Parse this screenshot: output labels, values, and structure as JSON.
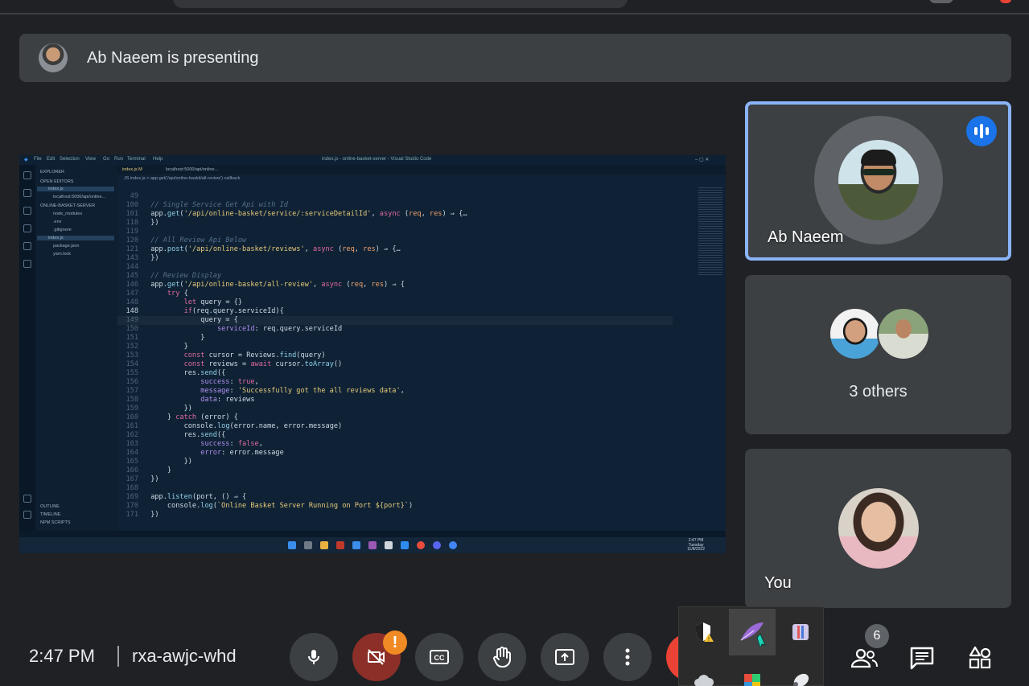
{
  "presenting": {
    "text": "Ab Naeem is presenting"
  },
  "shared_screen": {
    "window_title": "index.js - online-basket-server - Visual Studio Code",
    "menu": [
      "File",
      "Edit",
      "Selection",
      "View",
      "Go",
      "Run",
      "Terminal",
      "Help"
    ],
    "tabs": [
      "index.js M",
      "localhost:5000/api/online..."
    ],
    "breadcrumb": "JS index.js > app.get('/api/online-baskit/all-review') callback",
    "explorer": {
      "title": "EXPLORER",
      "open_editors": "OPEN EDITORS",
      "open_items": [
        "index.js",
        "localhost:5000/api/online..."
      ],
      "project": "ONLINE-BASKET-SERVER",
      "files": [
        "node_modules",
        ".env",
        ".gitignore",
        "index.js",
        "package.json",
        "yarn.lock"
      ],
      "footer": [
        "OUTLINE",
        "TIMELINE",
        "NPM SCRIPTS"
      ]
    },
    "taskbar_clock": {
      "time": "2:47 PM",
      "day": "Tuesday",
      "date": "11/8/2022"
    }
  },
  "tiles": {
    "presenter": {
      "name": "Ab Naeem"
    },
    "others": {
      "label": "3 others"
    },
    "self": {
      "name": "You"
    }
  },
  "bottom_bar": {
    "time": "2:47 PM",
    "meeting_code": "rxa-awjc-whd",
    "people_count": "6",
    "camera_warning": "!"
  },
  "icons": {
    "mic": "mic-icon",
    "camera_off": "camera-off-icon",
    "captions": "captions-icon",
    "raise_hand": "hand-icon",
    "present": "present-icon",
    "more": "more-vert-icon",
    "people": "people-icon",
    "chat": "chat-icon",
    "activities": "activities-icon"
  },
  "colors": {
    "background": "#202124",
    "surface": "#3c4043",
    "active_speaker_border": "#8ab4f8",
    "speaking_badge": "#1a73e8",
    "camera_off_button": "#8c2f28",
    "warning": "#f08a24",
    "hangup": "#ea4335"
  }
}
